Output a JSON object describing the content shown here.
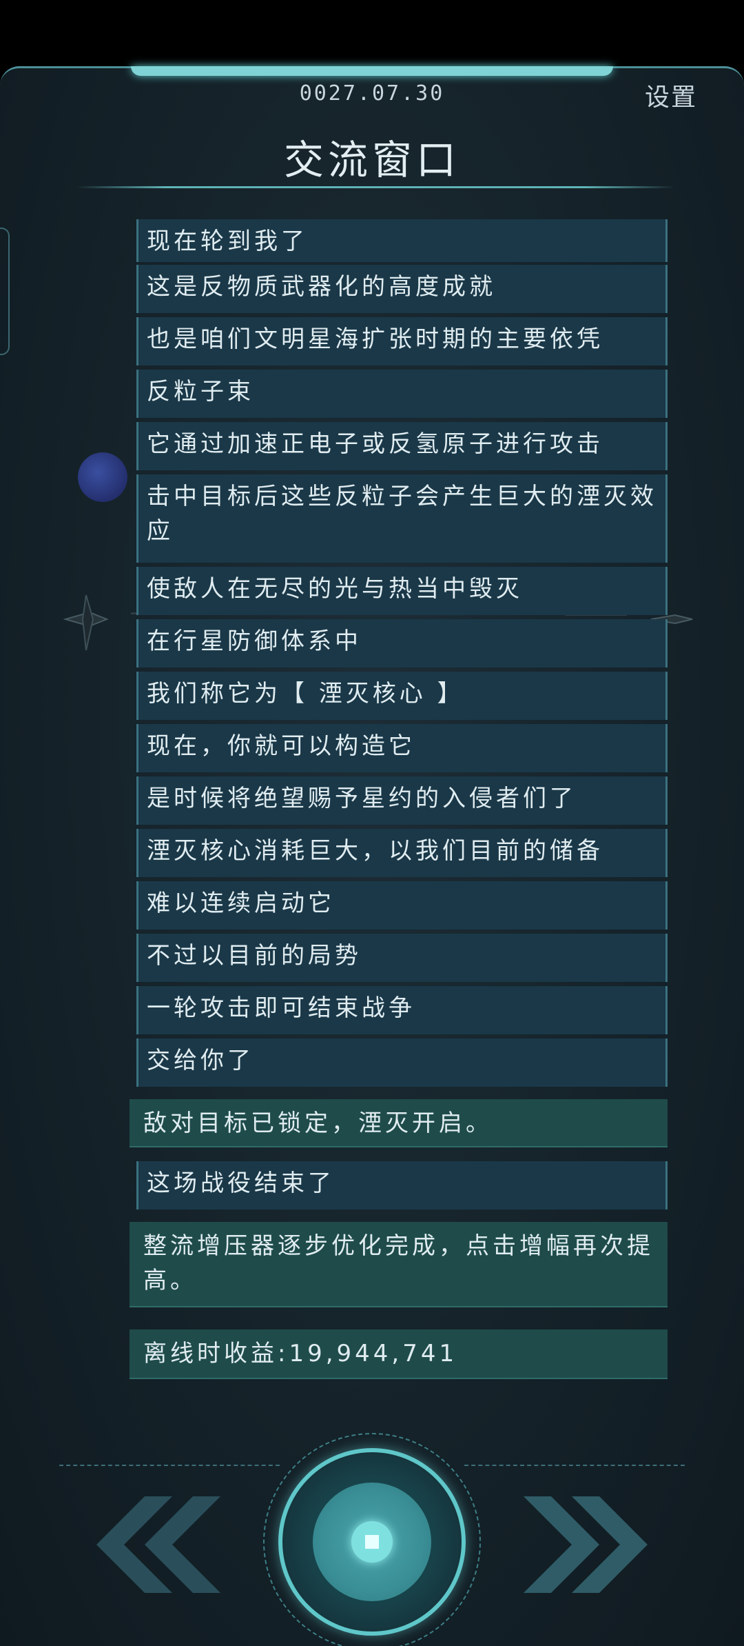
{
  "header": {
    "date": "0027.07.30",
    "settings_label": "设置",
    "title": "交流窗口"
  },
  "messages": [
    {
      "text": "现在轮到我了",
      "type": "dialog"
    },
    {
      "text": "这是反物质武器化的高度成就",
      "type": "dialog"
    },
    {
      "text": "也是咱们文明星海扩张时期的主要依凭",
      "type": "dialog"
    },
    {
      "text": "反粒子束",
      "type": "dialog"
    },
    {
      "text": "它通过加速正电子或反氢原子进行攻击",
      "type": "dialog"
    },
    {
      "text": "击中目标后这些反粒子会产生巨大的湮灭效应",
      "type": "dialog"
    },
    {
      "text": "使敌人在无尽的光与热当中毁灭",
      "type": "dialog"
    },
    {
      "text": "在行星防御体系中",
      "type": "dialog"
    },
    {
      "text": "我们称它为【 湮灭核心 】",
      "type": "dialog"
    },
    {
      "text": "现在，你就可以构造它",
      "type": "dialog"
    },
    {
      "text": "是时候将绝望赐予星约的入侵者们了",
      "type": "dialog"
    },
    {
      "text": "湮灭核心消耗巨大，以我们目前的储备",
      "type": "dialog"
    },
    {
      "text": "难以连续启动它",
      "type": "dialog"
    },
    {
      "text": "不过以目前的局势",
      "type": "dialog"
    },
    {
      "text": "一轮攻击即可结束战争",
      "type": "dialog"
    },
    {
      "text": "交给你了",
      "type": "dialog"
    },
    {
      "text": "敌对目标已锁定，湮灭开启。",
      "type": "system"
    },
    {
      "text": "这场战役结束了",
      "type": "dialog"
    },
    {
      "text": "整流增压器逐步优化完成，点击增幅再次提高。",
      "type": "system"
    },
    {
      "text": "离线时收益:19,944,741",
      "type": "system"
    }
  ],
  "controls": {
    "left_icon": "double-chevron-left-icon",
    "center_icon": "core-button-icon",
    "right_icon": "double-chevron-right-icon"
  },
  "colors": {
    "accent": "#5fc7c9",
    "dialog_bg": "#1a3848",
    "system_bg": "#1f4c4b",
    "background": "#152229"
  }
}
